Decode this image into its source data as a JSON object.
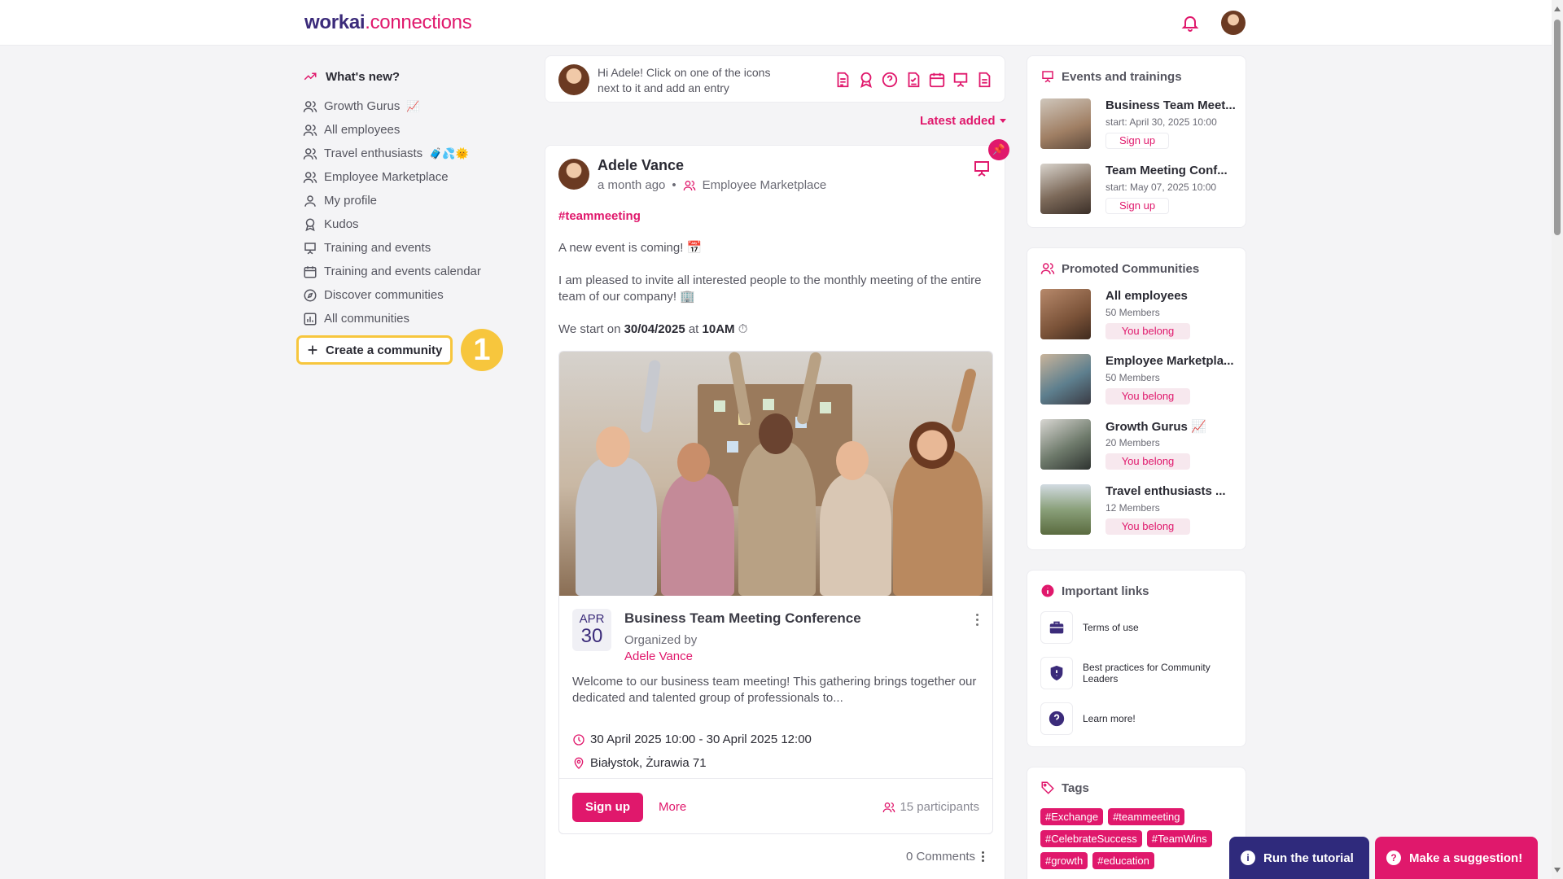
{
  "brand": {
    "name_a": "workai",
    "name_b": ".connections"
  },
  "sidebar": {
    "heading": "What's new?",
    "items": [
      {
        "label": "Growth Gurus",
        "emoji": "📈",
        "icon": "users-icon"
      },
      {
        "label": "All employees",
        "emoji": "",
        "icon": "users-icon"
      },
      {
        "label": "Travel enthusiasts",
        "emoji": "🧳💦🌞",
        "icon": "users-icon"
      },
      {
        "label": "Employee Marketplace",
        "emoji": "",
        "icon": "users-icon"
      },
      {
        "label": "My profile",
        "emoji": "",
        "icon": "user-icon"
      },
      {
        "label": "Kudos",
        "emoji": "",
        "icon": "award-icon"
      },
      {
        "label": "Training and events",
        "emoji": "",
        "icon": "presentation-icon"
      },
      {
        "label": "Training and events calendar",
        "emoji": "",
        "icon": "calendar-icon"
      },
      {
        "label": "Discover communities",
        "emoji": "",
        "icon": "compass-icon"
      },
      {
        "label": "All communities",
        "emoji": "",
        "icon": "chart-icon"
      }
    ],
    "create_label": "Create a community",
    "tutorial_step": "1"
  },
  "composer": {
    "prompt": "Hi Adele! Click on one of the icons next to it and add an entry"
  },
  "sort": {
    "label": "Latest added"
  },
  "post": {
    "author": "Adele Vance",
    "time": "a month ago",
    "community": "Employee Marketplace",
    "hashtag": "#teammeeting",
    "line1": "A new event is coming! 📅",
    "line2": "I am pleased to invite all interested people to the monthly meeting of the entire team of our company! 🏢",
    "line3_pre": "We start on ",
    "line3_date": "30/04/2025",
    "line3_mid": " at ",
    "line3_time": "10AM",
    "line3_post": " ⏱",
    "event": {
      "month": "APR",
      "day": "30",
      "title": "Business Team Meeting Conference",
      "organized_by": "Organized by",
      "organizer": "Adele Vance",
      "description": "Welcome to our business team meeting! This gathering brings together our dedicated and talented group of professionals to...",
      "when": "30 April 2025 10:00 - 30 April 2025 12:00",
      "where": "Białystok, Żurawia 71",
      "signup": "Sign up",
      "more": "More",
      "participants": "15 participants"
    },
    "comments": "0 Comments"
  },
  "events_card": {
    "title": "Events and trainings",
    "items": [
      {
        "title": "Business Team Meet...",
        "start": "start: April 30, 2025 10:00",
        "action": "Sign up"
      },
      {
        "title": "Team Meeting Conf...",
        "start": "start: May 07, 2025 10:00",
        "action": "Sign up"
      }
    ]
  },
  "communities_card": {
    "title": "Promoted Communities",
    "items": [
      {
        "title": "All employees",
        "members": "50 Members",
        "status": "You belong"
      },
      {
        "title": "Employee Marketpla...",
        "members": "50 Members",
        "status": "You belong"
      },
      {
        "title": "Growth Gurus 📈",
        "members": "20 Members",
        "status": "You belong"
      },
      {
        "title": "Travel enthusiasts ...",
        "members": "12 Members",
        "status": "You belong"
      }
    ]
  },
  "links_card": {
    "title": "Important links",
    "items": [
      {
        "label": "Terms of use",
        "icon": "briefcase-icon"
      },
      {
        "label": "Best practices for Community Leaders",
        "icon": "shield-icon"
      },
      {
        "label": "Learn more!",
        "icon": "help-icon"
      }
    ]
  },
  "tags_card": {
    "title": "Tags",
    "tags": [
      "#Exchange",
      "#teammeeting",
      "#CelebrateSuccess",
      "#TeamWins",
      "#growth",
      "#education"
    ]
  },
  "fabs": {
    "tutorial": "Run the tutorial",
    "suggestion": "Make a suggestion!"
  },
  "colors": {
    "accent": "#e0186c",
    "brand_dark": "#3b2b7a",
    "tutorial_fab": "#2f2a7c",
    "highlight": "#f7c63d"
  }
}
